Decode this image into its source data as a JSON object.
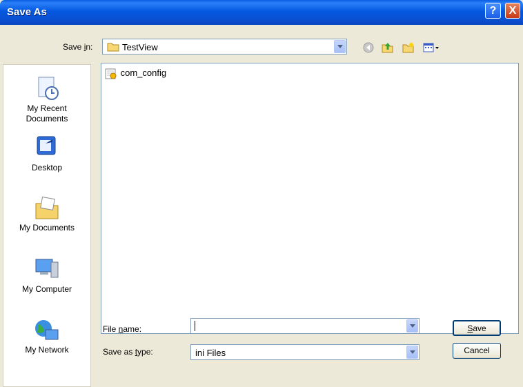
{
  "window": {
    "title": "Save As",
    "help_label": "?",
    "close_label": "X"
  },
  "toolbar": {
    "save_in_label": "Save in:",
    "save_in_value": "TestView",
    "icons": [
      "back-icon",
      "up-folder-icon",
      "new-folder-icon",
      "views-menu-icon"
    ]
  },
  "places": [
    {
      "label": "My Recent Documents",
      "line1": "My Recent",
      "line2": "Documents",
      "icon": "recent-documents-icon"
    },
    {
      "label": "Desktop",
      "icon": "desktop-icon"
    },
    {
      "label": "My Documents",
      "icon": "my-documents-icon"
    },
    {
      "label": "My Computer",
      "icon": "my-computer-icon"
    },
    {
      "label": "My Network",
      "icon": "my-network-icon"
    }
  ],
  "files": [
    {
      "name": "com_config",
      "icon": "ini-file-icon"
    }
  ],
  "form": {
    "file_name_label_pre": "File ",
    "file_name_label_u": "n",
    "file_name_label_post": "ame:",
    "file_name_value": "",
    "save_as_type_label_pre": "Save as ",
    "save_as_type_label_u": "t",
    "save_as_type_label_post": "ype:",
    "save_as_type_value": "ini Files"
  },
  "buttons": {
    "save_u": "S",
    "save_rest": "ave",
    "cancel": "Cancel"
  },
  "colors": {
    "title_bar": "#0a5ee0",
    "dialog_bg": "#ece9d8",
    "close_button": "#c73a15"
  }
}
